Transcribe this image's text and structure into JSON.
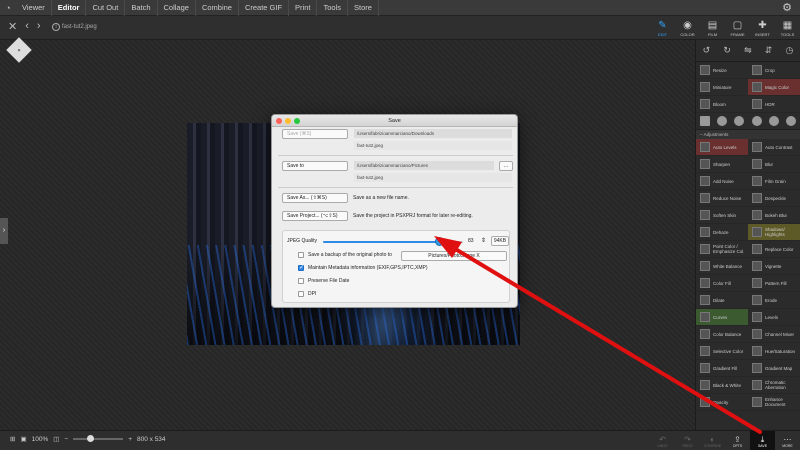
{
  "menubar": {
    "items": [
      "Viewer",
      "Editor",
      "Cut Out",
      "Batch",
      "Collage",
      "Combine",
      "Create GIF",
      "Print",
      "Tools",
      "Store"
    ],
    "active": "Editor"
  },
  "toolbar": {
    "filename": "fast-tut2.jpeg",
    "tools": [
      "EDIT",
      "COLOR",
      "FILM",
      "FRAME",
      "INSERT",
      "TOOLS"
    ],
    "active_tool": "EDIT"
  },
  "right_panel": {
    "top_cells": [
      {
        "label": "Resize",
        "hl": ""
      },
      {
        "label": "Crop",
        "hl": ""
      },
      {
        "label": "Miniature",
        "hl": ""
      },
      {
        "label": "Magic Color",
        "hl": "red"
      },
      {
        "label": "Bloom",
        "hl": ""
      },
      {
        "label": "HDR",
        "hl": ""
      }
    ],
    "adjustments_header": "Adjustments",
    "adjustments": [
      {
        "label": "Auto Levels",
        "hl": "red"
      },
      {
        "label": "Auto Contrast",
        "hl": ""
      },
      {
        "label": "Sharpen",
        "hl": ""
      },
      {
        "label": "Blur",
        "hl": ""
      },
      {
        "label": "Add Noise",
        "hl": ""
      },
      {
        "label": "Film Grain",
        "hl": ""
      },
      {
        "label": "Reduce Noise",
        "hl": ""
      },
      {
        "label": "Despeckle",
        "hl": ""
      },
      {
        "label": "Soften Skin",
        "hl": ""
      },
      {
        "label": "Bokeh Blur",
        "hl": ""
      },
      {
        "label": "Dehaze",
        "hl": ""
      },
      {
        "label": "Shadows/ Highlights",
        "hl": "yellow"
      },
      {
        "label": "Point Color / Emphasize Col.",
        "hl": ""
      },
      {
        "label": "Replace Color",
        "hl": ""
      },
      {
        "label": "White Balance",
        "hl": ""
      },
      {
        "label": "Vignette",
        "hl": ""
      },
      {
        "label": "Color Fill",
        "hl": ""
      },
      {
        "label": "Pattern Fill",
        "hl": ""
      },
      {
        "label": "Dilate",
        "hl": ""
      },
      {
        "label": "Erode",
        "hl": ""
      },
      {
        "label": "Curves",
        "hl": "green"
      },
      {
        "label": "Levels",
        "hl": ""
      },
      {
        "label": "Color Balance",
        "hl": ""
      },
      {
        "label": "Channel Mixer",
        "hl": ""
      },
      {
        "label": "Selective Color",
        "hl": ""
      },
      {
        "label": "Hue/Saturation",
        "hl": ""
      },
      {
        "label": "Gradient Fill",
        "hl": ""
      },
      {
        "label": "Gradient Map",
        "hl": ""
      },
      {
        "label": "Black & White",
        "hl": ""
      },
      {
        "label": "Chromatic Aberration",
        "hl": ""
      },
      {
        "label": "Opacity",
        "hl": ""
      },
      {
        "label": "Enhance Document",
        "hl": ""
      }
    ]
  },
  "statusbar": {
    "zoom": "100%",
    "size": "800 x 534",
    "tools": [
      "UNDO",
      "REDO",
      "COMPARE",
      "OPTS",
      "SAVE",
      "MORE"
    ],
    "active_tool": "SAVE"
  },
  "dialog": {
    "title": "Save",
    "save_label": "Save",
    "save_shortcut": "(⌘S)",
    "save_path": "/Users/fabrizioammarciano/Downloads",
    "save_file": "fast-tut2.jpeg",
    "save_to_label": "Save to",
    "save_to_path": "/Users/fabrizioammarciano/Pictures",
    "save_to_file": "fast-tut2.jpeg",
    "browse_label": "...",
    "save_as_label": "Save As...",
    "save_as_shortcut": "(⇧⌘S)",
    "save_as_desc": "Save as a new file name.",
    "save_project_label": "Save Project...",
    "save_project_shortcut": "(⌥⇧S)",
    "save_project_desc": "Save the project in PSXPRJ format for later re-editing.",
    "jpeg_quality_label": "JPEG Quality",
    "jpeg_quality_value": "83",
    "jpeg_quality_fraction": 0.83,
    "file_size": "94KB",
    "backup_label": "Save a backup of the original photo to",
    "backup_target": "Pictures/PhotoScape X",
    "metadata_label": "Maintain Metadata information (EXIF,GPS,IPTC,XMP)",
    "preserve_date_label": "Preserve File Date",
    "dpi_label": "DPI"
  },
  "colors": {
    "accent": "#2fa6ff",
    "annotation_arrow": "#e01010"
  }
}
